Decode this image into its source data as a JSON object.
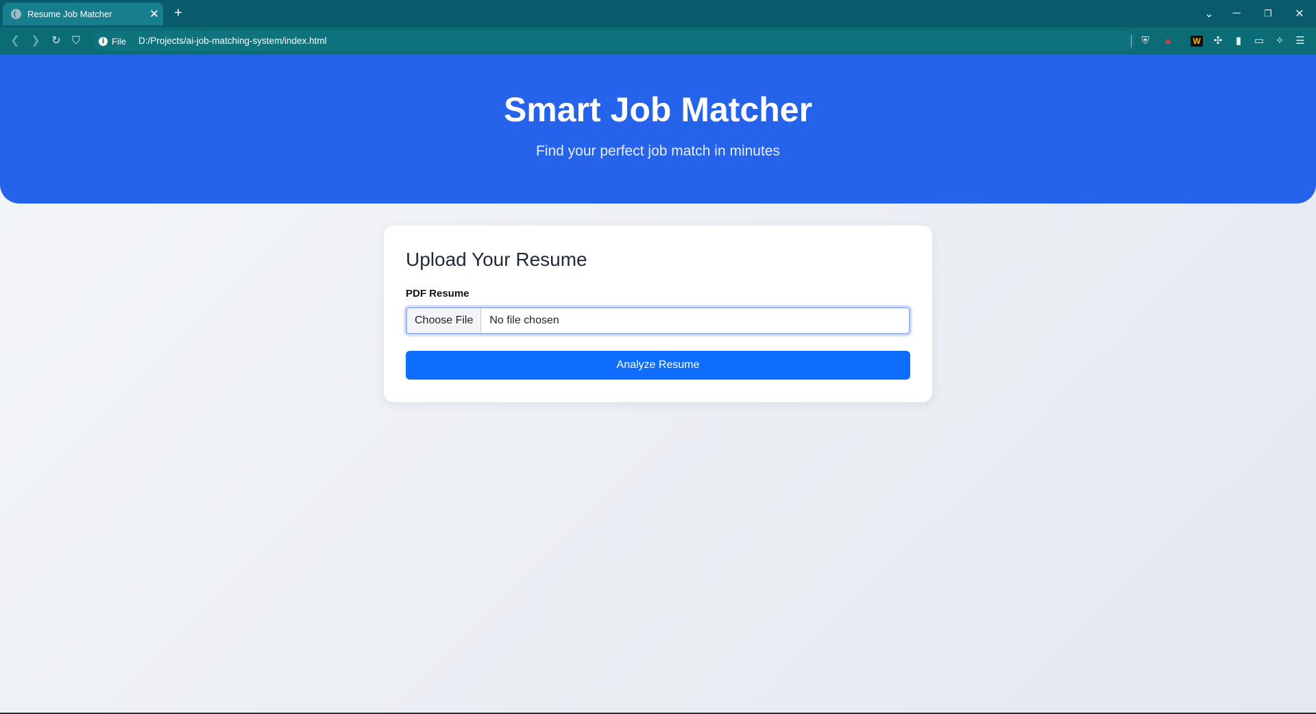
{
  "browser": {
    "tab_title": "Resume Job Matcher",
    "site_chip": "File",
    "url": "D:/Projects/ai-job-matching-system/index.html"
  },
  "hero": {
    "title": "Smart Job Matcher",
    "subtitle": "Find your perfect job match in minutes"
  },
  "card": {
    "heading": "Upload Your Resume",
    "field_label": "PDF Resume",
    "choose_file_label": "Choose File",
    "file_status": "No file chosen",
    "submit_label": "Analyze Resume"
  },
  "colors": {
    "hero": "#2563eb",
    "button": "#0d6efd",
    "chrome": "#095a6a"
  }
}
